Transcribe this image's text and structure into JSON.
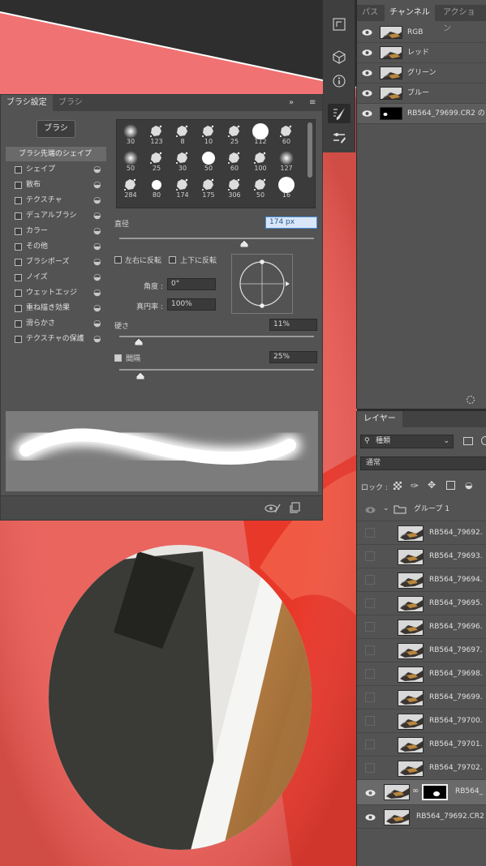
{
  "brush_panel": {
    "tabs": [
      "ブラシ設定",
      "ブラシ"
    ],
    "brush_button": "ブラシ",
    "options_header": "ブラシ先端のシェイプ",
    "options": [
      {
        "label": "シェイプ",
        "checked": false
      },
      {
        "label": "散布",
        "checked": false
      },
      {
        "label": "テクスチャ",
        "checked": false
      },
      {
        "label": "デュアルブラシ",
        "checked": false
      },
      {
        "label": "カラー",
        "checked": false
      },
      {
        "label": "その他",
        "checked": false
      },
      {
        "label": "ブラシポーズ",
        "checked": false
      },
      {
        "label": "ノイズ",
        "checked": false
      },
      {
        "label": "ウェットエッジ",
        "checked": false
      },
      {
        "label": "重ね描き効果",
        "checked": false
      },
      {
        "label": "滑らかさ",
        "checked": false
      },
      {
        "label": "テクスチャの保護",
        "checked": false
      }
    ],
    "preset_sizes": [
      "30",
      "123",
      "8",
      "10",
      "25",
      "112",
      "60",
      "50",
      "25",
      "30",
      "50",
      "60",
      "100",
      "127",
      "284",
      "80",
      "174",
      "175",
      "306",
      "50",
      "16"
    ],
    "diameter_label": "直径",
    "diameter_value": "174 px",
    "flip_x_label": "左右に反転",
    "flip_y_label": "上下に反転",
    "angle_label": "角度 :",
    "angle_value": "0°",
    "roundness_label": "真円率 :",
    "roundness_value": "100%",
    "hardness_label": "硬さ",
    "hardness_value": "11%",
    "spacing_label": "間隔",
    "spacing_value": "25%",
    "spacing_checked": true
  },
  "channels_panel": {
    "tabs": [
      "パス",
      "チャンネル",
      "アクション"
    ],
    "channels": [
      {
        "name": "RGB"
      },
      {
        "name": "レッド"
      },
      {
        "name": "グリーン"
      },
      {
        "name": "ブルー"
      },
      {
        "name": "RB564_79699.CR2 の"
      }
    ]
  },
  "layers_panel": {
    "tab": "レイヤー",
    "filter_label": "種類",
    "blend_mode": "通常",
    "lock_label": "ロック :",
    "group_name": "グループ 1",
    "layers": [
      "RB564_79692.",
      "RB564_79693.",
      "RB564_79694.",
      "RB564_79695.",
      "RB564_79696.",
      "RB564_79697.",
      "RB564_79698.",
      "RB564_79699.",
      "RB564_79700.",
      "RB564_79701.",
      "RB564_79702."
    ],
    "selected_layer": "RB564_",
    "bottom_layer": "RB564_79692.CR2"
  },
  "colors": {
    "canvas_red": "#e2574e",
    "panel": "#535353",
    "accent": "#4a90d9"
  }
}
